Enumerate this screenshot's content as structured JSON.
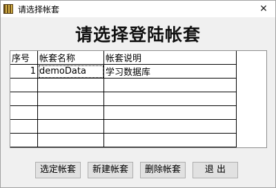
{
  "window": {
    "title": "请选择帐套",
    "close_glyph": "✕"
  },
  "dialog": {
    "heading": "请选择登陆帐套"
  },
  "table": {
    "headers": [
      "序号",
      "帐套名称",
      "帐套说明"
    ],
    "rows": [
      [
        "1",
        "demoData",
        "学习数据库"
      ],
      [
        "",
        "",
        ""
      ],
      [
        "",
        "",
        ""
      ],
      [
        "",
        "",
        ""
      ],
      [
        "",
        "",
        ""
      ],
      [
        "",
        "",
        ""
      ]
    ]
  },
  "buttons": {
    "select": "选定帐套",
    "new": "新建帐套",
    "delete": "删除帐套",
    "exit": "退 出"
  },
  "icons": {
    "app": "app-icon",
    "close": "close-icon"
  }
}
